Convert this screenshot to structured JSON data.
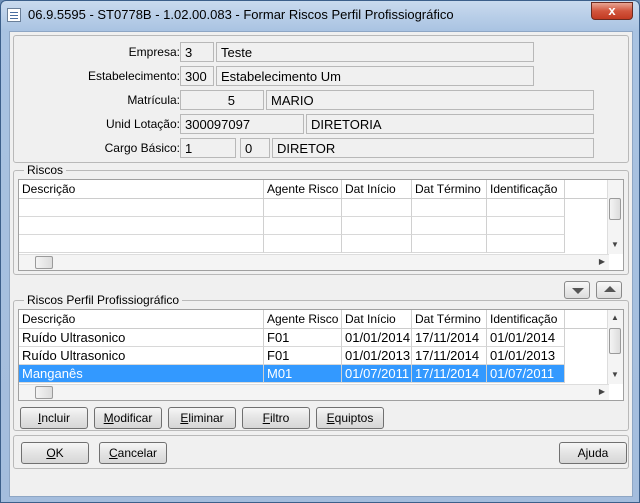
{
  "window": {
    "title": "06.9.5595 - ST0778B - 1.02.00.083 - Formar Riscos Perfil Profissiográfico",
    "close": "x"
  },
  "header": {
    "empresa": {
      "label": "Empresa:",
      "code": "3",
      "name": "Teste"
    },
    "estabelecimento": {
      "label": "Estabelecimento:",
      "code": "300",
      "name": "Estabelecimento Um"
    },
    "matricula": {
      "label": "Matrícula:",
      "code": "5",
      "name": "MARIO"
    },
    "unid_lotacao": {
      "label": "Unid Lotação:",
      "code": "300097097",
      "name": "DIRETORIA"
    },
    "cargo_basico": {
      "label": "Cargo Básico:",
      "code": "1",
      "level": "0",
      "name": "DIRETOR"
    }
  },
  "riscos": {
    "title": "Riscos",
    "columns": [
      "Descrição",
      "Agente Risco",
      "Dat Início",
      "Dat Término",
      "Identificação"
    ]
  },
  "riscos_ppp": {
    "title": "Riscos Perfil Profissiográfico",
    "columns": [
      "Descrição",
      "Agente Risco",
      "Dat Início",
      "Dat Término",
      "Identificação"
    ],
    "rows": [
      {
        "descricao": "Ruído Ultrasonico",
        "agente": "F01",
        "inicio": "01/01/2014",
        "termino": "17/11/2014",
        "ident": "01/01/2014"
      },
      {
        "descricao": "Ruído Ultrasonico",
        "agente": "F01",
        "inicio": "01/01/2013",
        "termino": "17/11/2014",
        "ident": "01/01/2013"
      },
      {
        "descricao": "Manganês",
        "agente": "M01",
        "inicio": "01/07/2011",
        "termino": "17/11/2014",
        "ident": "01/07/2011"
      }
    ]
  },
  "buttons": {
    "incluir_u": "I",
    "incluir_rest": "ncluir",
    "modificar_u": "M",
    "modificar_rest": "odificar",
    "eliminar_u": "E",
    "eliminar_rest": "liminar",
    "filtro_u": "F",
    "filtro_rest": "iltro",
    "equiptos_u": "E",
    "equiptos_rest": "quiptos",
    "ok_u": "O",
    "ok_rest": "K",
    "cancelar_u": "C",
    "cancelar_rest": "ancelar",
    "ajuda": "Ajuda"
  }
}
